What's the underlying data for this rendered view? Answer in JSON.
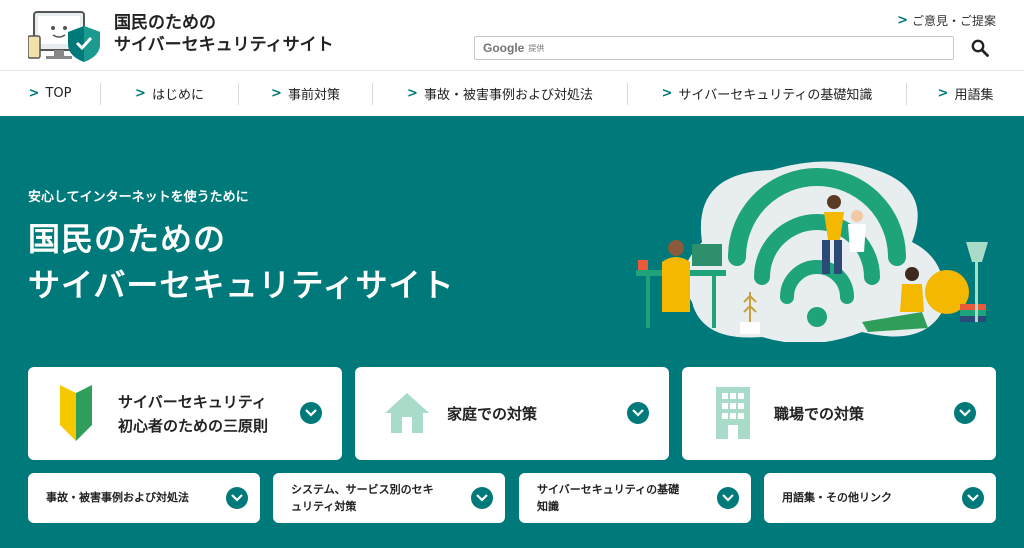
{
  "header": {
    "site_title_line1": "国民のための",
    "site_title_line2": "サイバーセキュリティサイト",
    "feedback": "ご意見・ご提案",
    "search_brand": "Google",
    "search_provided": "提供"
  },
  "nav": [
    {
      "label": "TOP"
    },
    {
      "label": "はじめに"
    },
    {
      "label": "事前対策"
    },
    {
      "label": "事故・被害事例および対処法"
    },
    {
      "label": "サイバーセキュリティの基礎知識"
    },
    {
      "label": "用語集"
    }
  ],
  "hero": {
    "subtitle": "安心してインターネットを使うために",
    "title_line1": "国民のための",
    "title_line2": "サイバーセキュリティサイト"
  },
  "big_cards": [
    {
      "line1": "サイバーセキュリティ",
      "line2": "初心者のための三原則"
    },
    {
      "line1": "家庭での対策",
      "line2": ""
    },
    {
      "line1": "職場での対策",
      "line2": ""
    }
  ],
  "small_cards": [
    {
      "line1": "事故・被害事例および対処法",
      "line2": ""
    },
    {
      "line1": "システム、サービス別のセキ",
      "line2": "ュリティ対策"
    },
    {
      "line1": "サイバーセキュリティの基礎",
      "line2": "知識"
    },
    {
      "line1": "用語集・その他リンク",
      "line2": ""
    }
  ],
  "colors": {
    "brand_teal": "#00797a",
    "icon_mint": "#a8dcc8",
    "accent_yellow": "#f5b800",
    "accent_green": "#2f9e5b"
  }
}
